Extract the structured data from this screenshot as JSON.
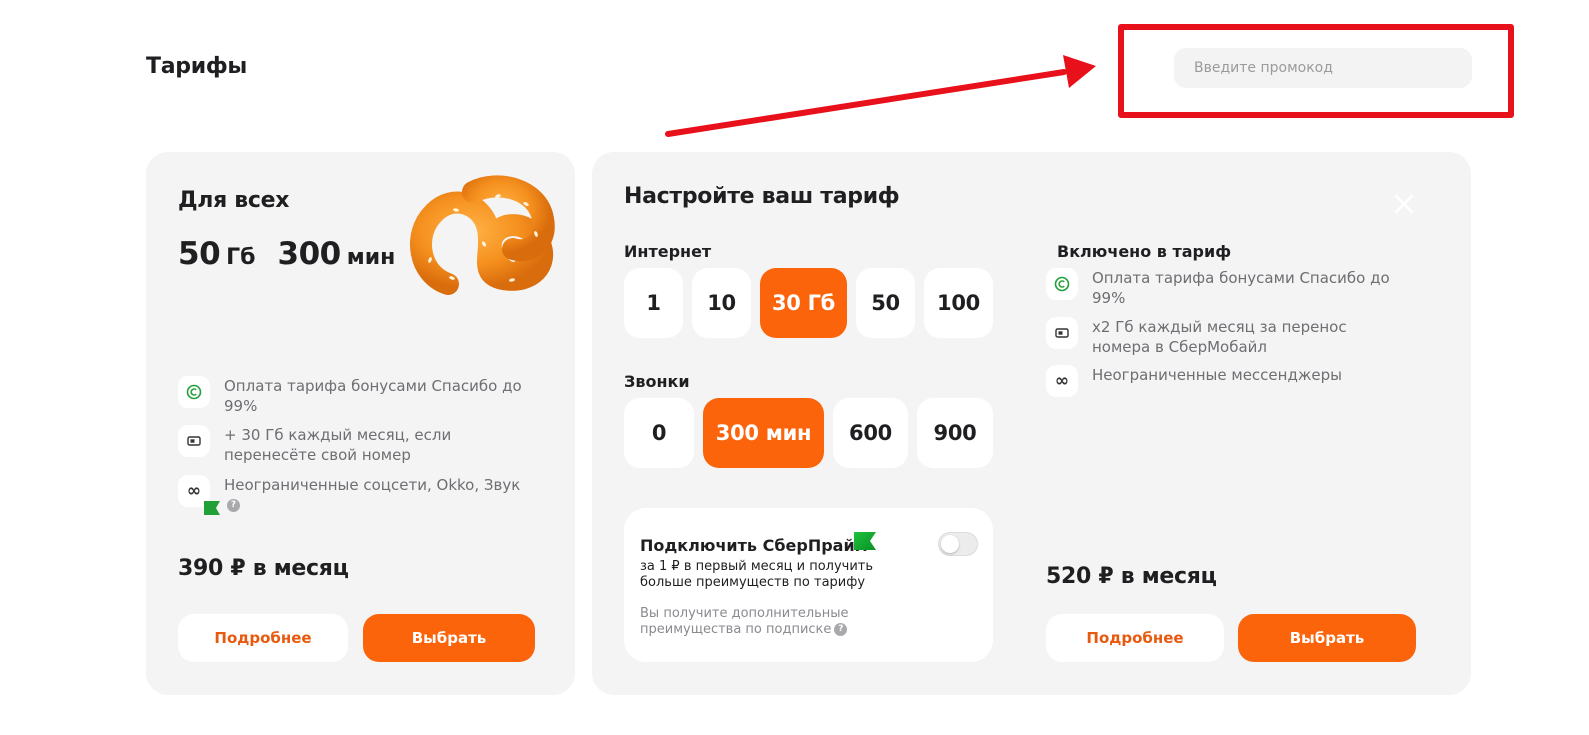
{
  "page": {
    "title": "Тарифы"
  },
  "promo": {
    "placeholder": "Введите промокод"
  },
  "annotation": {
    "color": "#e8101a"
  },
  "colors": {
    "accent": "#fb640b",
    "card_bg": "#f4f4f4",
    "bonus_green": "#21a038"
  },
  "left_card": {
    "title": "Для всех",
    "internet_value": "50",
    "internet_unit": "Гб",
    "minutes_value": "300",
    "minutes_unit": "мин",
    "features": [
      {
        "icon": "spasibo-icon",
        "text": "Оплата тарифа бонусами Спасибо до 99%"
      },
      {
        "icon": "sim-card-icon",
        "text": "+ 30 Гб каждый месяц, если перенесёте свой номер"
      },
      {
        "icon": "infinity-icon",
        "text": "Неограниченные соцсети, Okko, Звук"
      }
    ],
    "price": "390 ₽ в месяц",
    "details_label": "Подробнее",
    "choose_label": "Выбрать"
  },
  "right_card": {
    "title": "Настройте ваш тариф",
    "internet": {
      "label": "Интернет",
      "options": [
        "1",
        "10",
        "30 Гб",
        "50",
        "100"
      ],
      "selected": "30 Гб"
    },
    "calls": {
      "label": "Звонки",
      "options": [
        "0",
        "300 мин",
        "600",
        "900"
      ],
      "selected": "300 мин"
    },
    "prime": {
      "title": "Подключить СберПрайм",
      "subtitle": "за 1 ₽ в первый месяц и получить больше преимуществ по тарифу",
      "note": "Вы получите дополнительные преимущества по подписке",
      "enabled": false
    },
    "included": {
      "title": "Включено в тариф",
      "features": [
        {
          "icon": "spasibo-icon",
          "text": "Оплата тарифа бонусами Спасибо до 99%"
        },
        {
          "icon": "sim-card-icon",
          "text": "x2 Гб каждый месяц за перенос номера в СберМобайл"
        },
        {
          "icon": "infinity-icon",
          "text": "Неограниченные мессенджеры"
        }
      ]
    },
    "price": "520 ₽ в месяц",
    "details_label": "Подробнее",
    "choose_label": "Выбрать"
  }
}
